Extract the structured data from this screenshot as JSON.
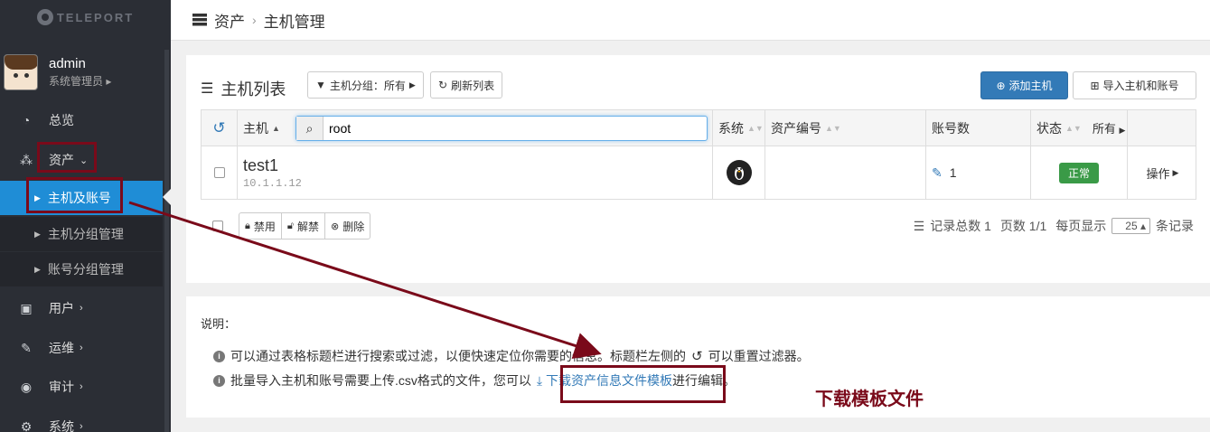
{
  "app": {
    "logo_text": "TELEPORT"
  },
  "user": {
    "name": "admin",
    "role": "系统管理员"
  },
  "sidebar": {
    "items": [
      {
        "label": "总览",
        "icon": "dashboard-icon"
      },
      {
        "label": "资产",
        "icon": "cubes-icon"
      },
      {
        "label": "用户",
        "icon": "user-card-icon"
      },
      {
        "label": "运维",
        "icon": "wrench-icon"
      },
      {
        "label": "审计",
        "icon": "eye-icon"
      },
      {
        "label": "系统",
        "icon": "gear-icon"
      }
    ],
    "sub_items": [
      {
        "label": "主机及账号"
      },
      {
        "label": "主机分组管理"
      },
      {
        "label": "账号分组管理"
      }
    ]
  },
  "breadcrumb": {
    "root": "资产",
    "current": "主机管理"
  },
  "host_list": {
    "title": "主机列表",
    "group_filter": "主机分组：所有",
    "refresh": "刷新列表",
    "add_host": "添加主机",
    "import": "导入主机和账号"
  },
  "table": {
    "headers": {
      "host": "主机",
      "os": "系统",
      "asset_no": "资产编号",
      "accounts": "账号数",
      "status": "状态",
      "status_filter": "所有"
    },
    "search_value": "root",
    "rows": [
      {
        "name": "test1",
        "ip": "10.1.1.12",
        "asset_no": "",
        "accounts": "1",
        "status": "正常",
        "action": "操作"
      }
    ]
  },
  "bulk_actions": {
    "disable": "禁用",
    "unlock": "解禁",
    "delete": "删除"
  },
  "pager": {
    "total": "记录总数 1",
    "pages": "页数 1/1",
    "per_page_label": "每页显示",
    "per_page": "25",
    "unit": "条记录"
  },
  "notes": {
    "label": "说明：",
    "line1_a": "可以通过表格标题栏进行搜索或过滤，以便快速定位你需要的信息。标题栏左侧的",
    "line1_b": "可以重置过滤器。",
    "line2_a": "批量导入主机和账号需要上传.csv格式的文件，您可以",
    "line2_link": "下载资产信息文件模板",
    "line2_b": "进行编辑。"
  },
  "annotation": {
    "text": "下载模板文件"
  },
  "colors": {
    "sidebar_bg": "#2b2e35",
    "active_blue": "#1f8dd6",
    "primary": "#337ab7",
    "ok_green": "#3a9a47",
    "annotation_red": "#7a0a1a"
  }
}
